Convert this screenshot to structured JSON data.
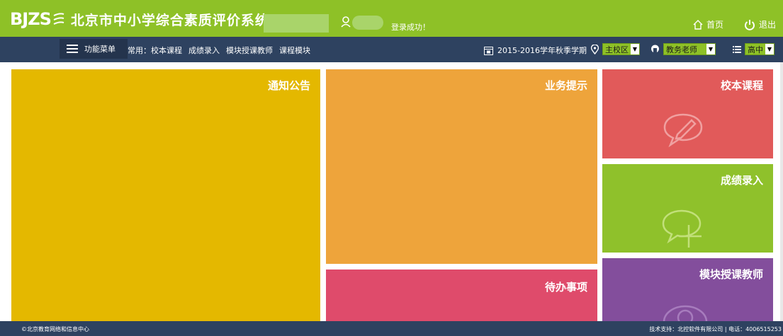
{
  "header": {
    "logo_text": "BJZS",
    "title": "北京市中小学综合素质评价系统",
    "login_status": "登录成功！",
    "home_label": "首页",
    "logout_label": "退出"
  },
  "navbar": {
    "menu_label": "功能菜单",
    "common_prefix": "常用：",
    "common_links": [
      "校本课程",
      "成绩录入",
      "模块授课教师",
      "课程模块"
    ],
    "term": "2015-2016学年秋季学期",
    "campus": "主校区",
    "role": "教务老师",
    "level": "高中"
  },
  "tiles": {
    "notice": "通知公告",
    "business": "业务提示",
    "todo": "待办事项",
    "course": "校本课程",
    "score": "成绩录入",
    "teacher": "模块授课教师"
  },
  "footer": {
    "left": "©北京教育网络和信息中心",
    "right": "技术支持：北控软件有限公司 | 电话：4006515253"
  },
  "icons": [
    "logo-swoosh-icon",
    "user-icon",
    "home-icon",
    "power-icon",
    "menu-icon",
    "calendar-icon",
    "location-icon",
    "person-icon",
    "list-icon",
    "chat-pencil-icon",
    "chat-plus-icon",
    "eye-icon"
  ],
  "colors": {
    "topbar": "#8ec127",
    "navbar": "#2e4260",
    "notice": "#e4b800",
    "business": "#eea43b",
    "todo": "#df4b6b",
    "course": "#e15a5a",
    "score": "#8fc12b",
    "teacher": "#834e9c"
  }
}
